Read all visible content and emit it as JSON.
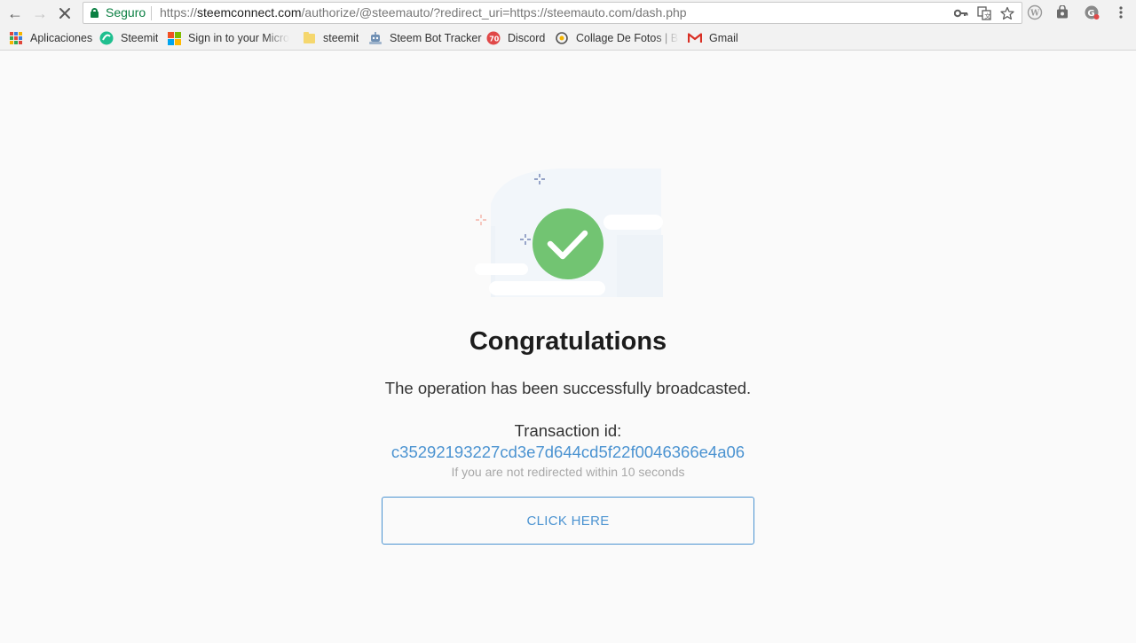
{
  "browser": {
    "secure_label": "Seguro",
    "url_scheme": "https://",
    "url_host": "steemconnect.com",
    "url_path": "/authorize/@steemauto/?redirect_uri=https://steemauto.com/dash.php",
    "nav_icons": {
      "back": "back-arrow-icon",
      "forward": "forward-arrow-icon",
      "stop": "stop-loading-icon"
    },
    "omnibox_icons": [
      "key-icon",
      "translate-icon",
      "star-icon"
    ],
    "extensions": [
      "wordpress-icon",
      "bag-icon",
      "grammarly-icon",
      "menu-icon"
    ]
  },
  "bookmarks": [
    {
      "label": "Aplicaciones",
      "icon": "apps-grid-icon"
    },
    {
      "label": "Steemit",
      "icon": "steemit-icon"
    },
    {
      "label": "Sign in to your Micro",
      "icon": "microsoft-icon"
    },
    {
      "label": "steemit",
      "icon": "folder-icon"
    },
    {
      "label": "Steem Bot Tracker",
      "icon": "bot-tracker-icon"
    },
    {
      "label": "Discord",
      "icon": "discord-icon"
    },
    {
      "label": "Collage De Fotos | Be",
      "icon": "collage-icon"
    },
    {
      "label": "Gmail",
      "icon": "gmail-icon"
    }
  ],
  "content": {
    "title": "Congratulations",
    "message": "The operation has been successfully broadcasted.",
    "transaction_label": "Transaction id:",
    "transaction_id": "c35292193227cd3e7d644cd5f22f0046366e4a06",
    "redirect_note": "If you are not redirected within 10 seconds",
    "button_label": "CLICK HERE"
  },
  "colors": {
    "success_green": "#72c472",
    "link_blue": "#4b93d1",
    "secure_green": "#0b8043",
    "sparkle_blue": "#5b6fa8",
    "sparkle_red": "#f2a69a"
  }
}
